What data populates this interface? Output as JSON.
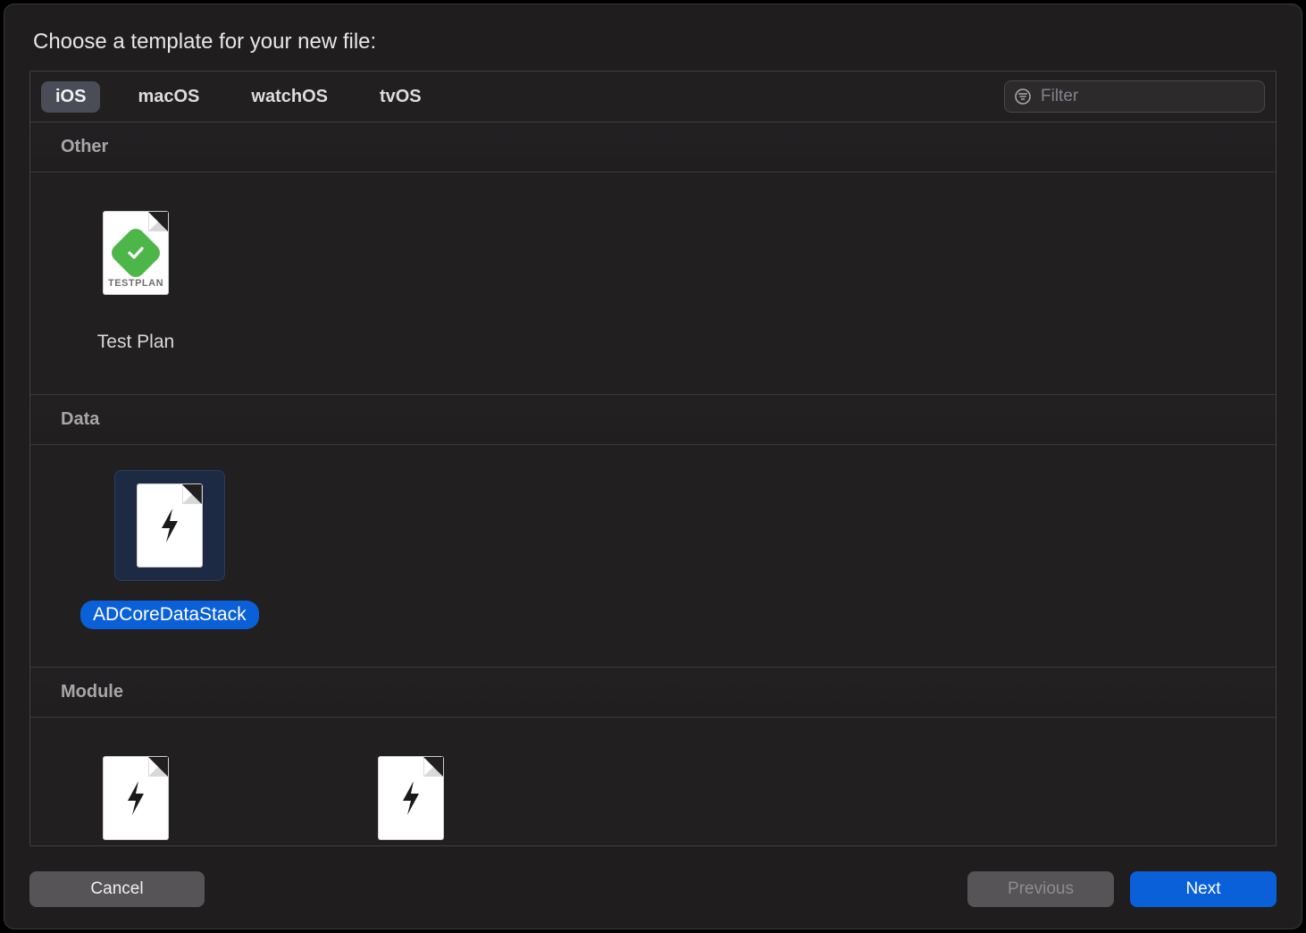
{
  "dialog": {
    "title": "Choose a template for your new file:"
  },
  "platforms": {
    "ios": "iOS",
    "macos": "macOS",
    "watchos": "watchOS",
    "tvos": "tvOS",
    "active": "iOS"
  },
  "filter": {
    "placeholder": "Filter",
    "value": ""
  },
  "sections": [
    {
      "header": "Other",
      "items": [
        {
          "label": "Test Plan",
          "icon": "testplan",
          "badge_text": "TESTPLAN",
          "selected": false
        }
      ]
    },
    {
      "header": "Data",
      "items": [
        {
          "label": "ADCoreDataStack",
          "icon": "generic-file",
          "selected": true
        }
      ]
    },
    {
      "header": "Module",
      "items": [
        {
          "label": "",
          "icon": "generic-file",
          "selected": false
        },
        {
          "label": "",
          "icon": "generic-file",
          "selected": false
        }
      ]
    }
  ],
  "footer": {
    "cancel": "Cancel",
    "previous": "Previous",
    "next": "Next"
  }
}
